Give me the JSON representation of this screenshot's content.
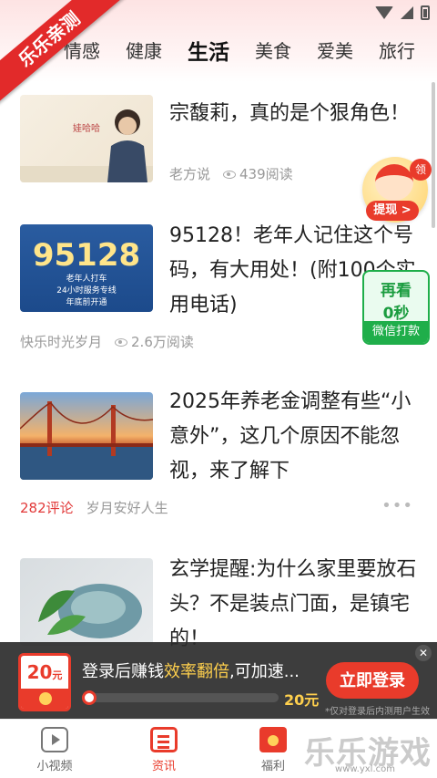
{
  "ribbon": {
    "text": "乐乐亲测"
  },
  "tabs": [
    {
      "label": "情感",
      "active": false
    },
    {
      "label": "健康",
      "active": false
    },
    {
      "label": "生活",
      "active": true
    },
    {
      "label": "美食",
      "active": false
    },
    {
      "label": "爱美",
      "active": false
    },
    {
      "label": "旅行",
      "active": false
    }
  ],
  "articles": [
    {
      "title": "宗馥莉，真的是个狠角色！",
      "source": "老方说",
      "reads": "439阅读",
      "thumb_icon": "portrait-photo"
    },
    {
      "title": "95128！老年人记住这个号码，有大用处！(附100个实用电话)",
      "source": "快乐时光岁月",
      "reads": "2.6万阅读",
      "thumb": {
        "big": "95128",
        "line1": "老年人打车",
        "line2": "24小时服务专线",
        "line3": "年底前开通"
      }
    },
    {
      "title": "2025年养老金调整有些“小意外”，这几个原因不能忽视，来了解下",
      "comments": "282评论",
      "source": "岁月安好人生",
      "thumb_icon": "bridge-photo"
    },
    {
      "title": "玄学提醒:为什么家里要放石头？不是装点门面，是镇宅的！",
      "thumb_icon": "stone-leaf-photo"
    }
  ],
  "float_gift": {
    "badge": "领",
    "pill": "提现 >"
  },
  "reread": {
    "line1": "再看",
    "line2": "0秒",
    "line3": "微信打款"
  },
  "promo": {
    "coupon_amount": "20",
    "coupon_unit": "元",
    "text_prefix": "登录后赚钱",
    "text_highlight": "效率翻倍",
    "text_suffix": ",可加速...",
    "progress": 0.0,
    "progress_amount": "20元",
    "button": "立即登录",
    "note": "*仅对登录后内测用户生效",
    "close": "✕"
  },
  "bottom_nav": [
    {
      "label": "小视频",
      "icon": "video-icon",
      "active": false
    },
    {
      "label": "资讯",
      "icon": "news-icon",
      "active": true
    },
    {
      "label": "福利",
      "icon": "gift-icon",
      "active": false
    }
  ],
  "watermark": {
    "text": "乐乐游戏",
    "url": "www.yxl.com"
  },
  "colors": {
    "accent": "#e93b2b",
    "green": "#1fae4a",
    "highlight": "#ffd04d"
  }
}
